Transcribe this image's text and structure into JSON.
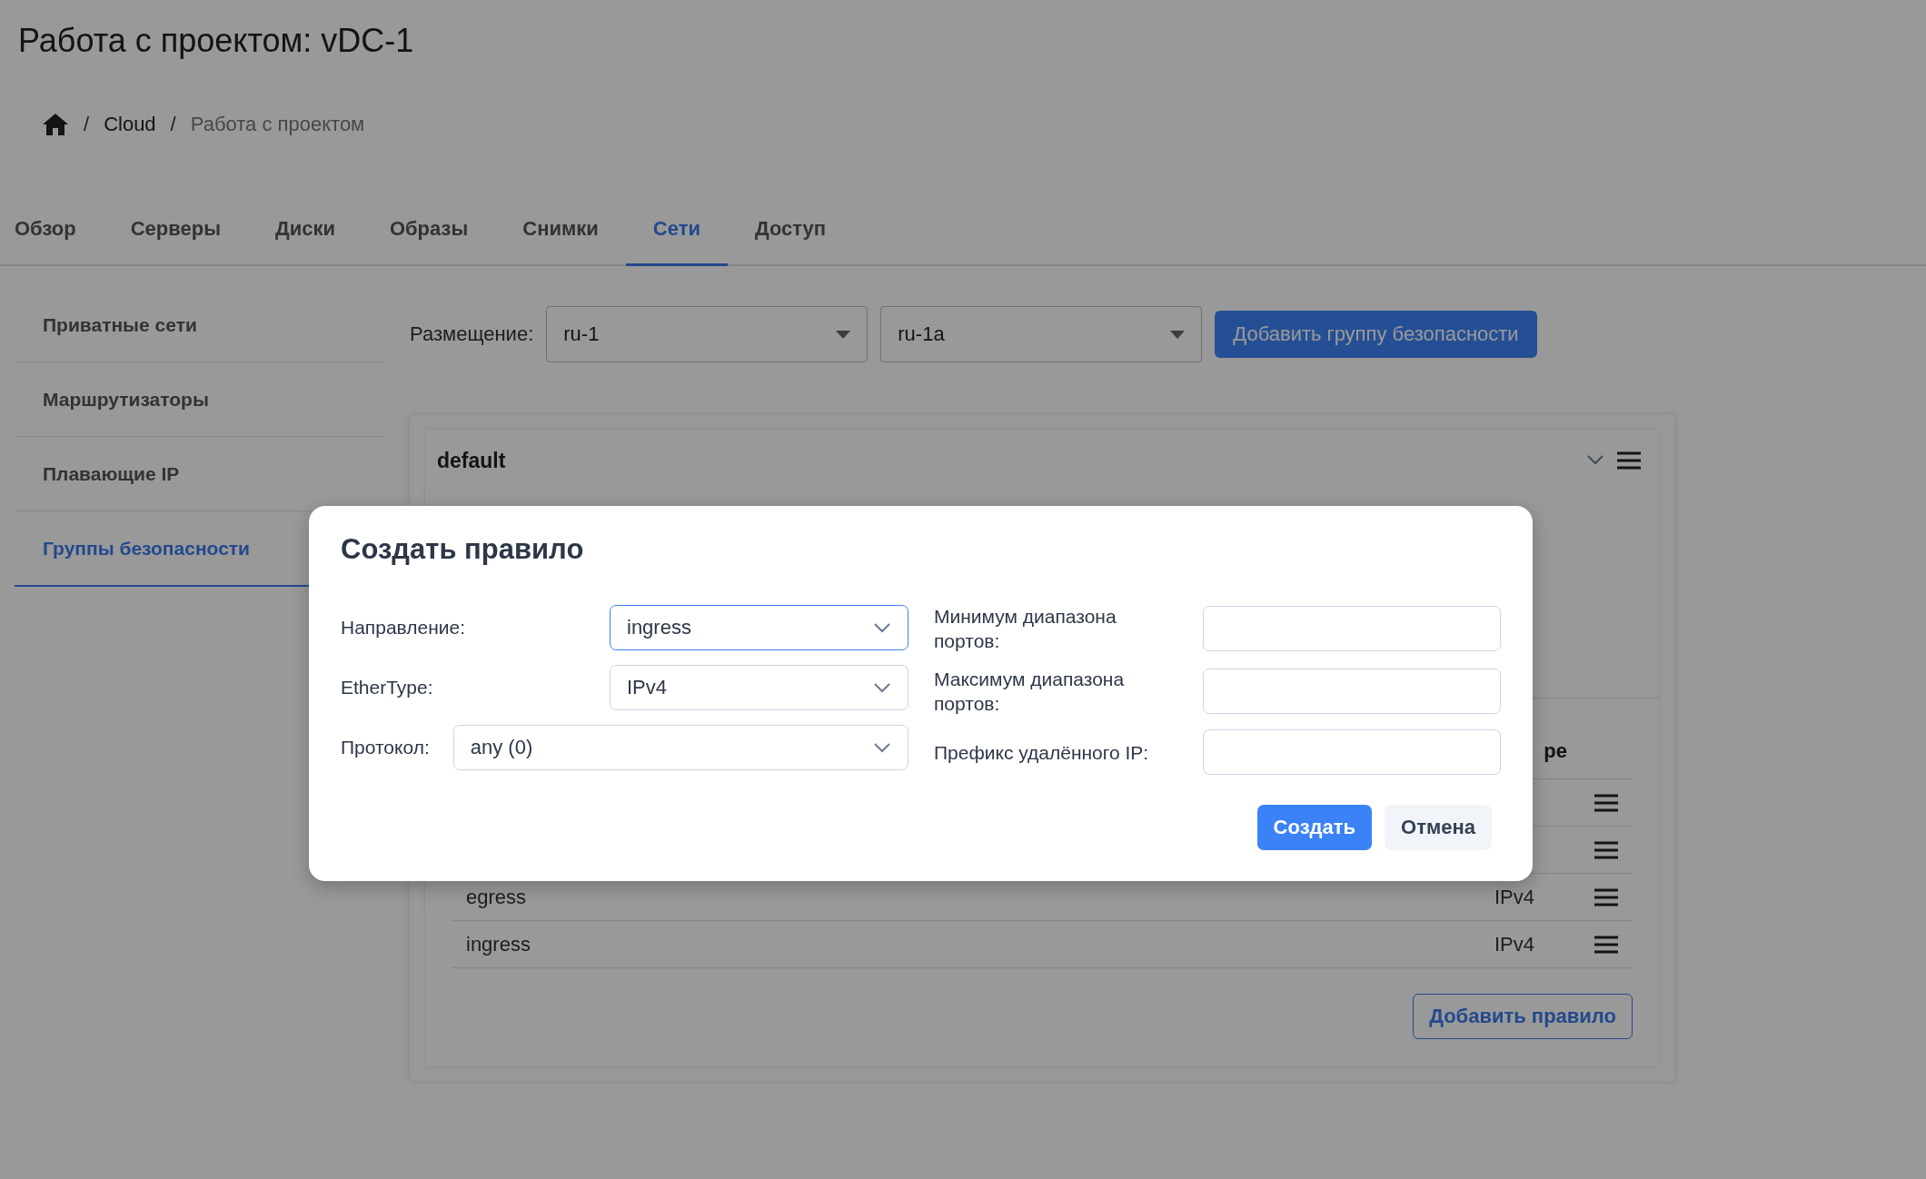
{
  "page_title": "Работа с проектом: vDC-1",
  "breadcrumb": [
    {
      "separator": "/",
      "label": "Cloud",
      "current": false
    },
    {
      "separator": "/",
      "label": "Работа с проектом",
      "current": true
    }
  ],
  "tabs": [
    {
      "label": "Обзор",
      "selected": false
    },
    {
      "label": "Серверы",
      "selected": false
    },
    {
      "label": "Диски",
      "selected": false
    },
    {
      "label": "Образы",
      "selected": false
    },
    {
      "label": "Снимки",
      "selected": false
    },
    {
      "label": "Сети",
      "selected": true
    },
    {
      "label": "Доступ",
      "selected": false
    }
  ],
  "sidebar": {
    "items": [
      {
        "label": "Приватные сети",
        "selected": false
      },
      {
        "label": "Маршрутизаторы",
        "selected": false
      },
      {
        "label": "Плавающие IP",
        "selected": false
      },
      {
        "label": "Группы безопасности",
        "selected": true
      }
    ]
  },
  "placement": {
    "label": "Размещение:",
    "region": "ru-1",
    "zone": "ru-1a"
  },
  "add_group_button": "Добавить группу безопасности",
  "security_group": {
    "name": "default",
    "table": {
      "column_header": "pe",
      "rows": [
        {
          "kind": "covered"
        },
        {
          "kind": "covered"
        },
        {
          "kind": "rule",
          "direction": "egress",
          "ethertype": "IPv4"
        },
        {
          "kind": "rule",
          "direction": "ingress",
          "ethertype": "IPv4"
        }
      ]
    },
    "add_rule_button": "Добавить правило"
  },
  "dialog": {
    "title": "Создать правило",
    "fields_left": [
      {
        "label": "Направление:",
        "value": "ingress",
        "focused": true
      },
      {
        "label": "EtherType:",
        "value": "IPv4",
        "focused": false
      },
      {
        "label": "Протокол:",
        "value": "any (0)",
        "focused": false
      }
    ],
    "fields_right": [
      {
        "label": "Минимум диапазона портов:"
      },
      {
        "label": "Максимум диапазона портов:"
      },
      {
        "label": "Префикс удалённого IP:"
      }
    ],
    "buttons": [
      {
        "label": "Создать",
        "kind": "primary"
      },
      {
        "label": "Отмена",
        "kind": "secondary"
      }
    ]
  }
}
